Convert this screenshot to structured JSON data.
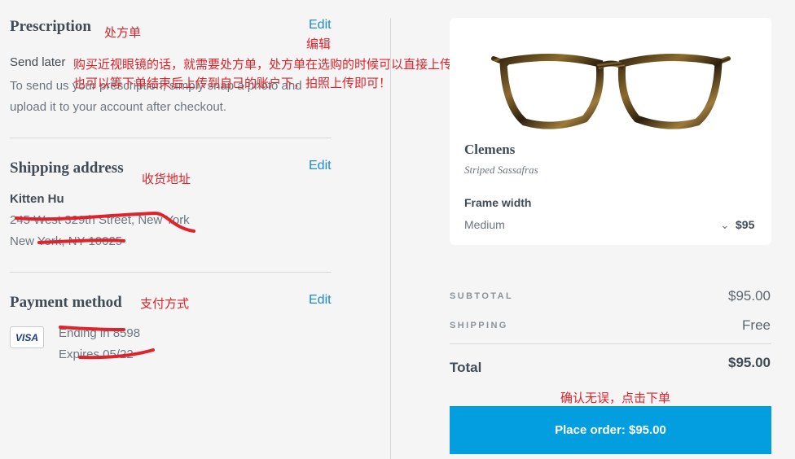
{
  "prescription": {
    "title": "Prescription",
    "annot_title": "处方单",
    "edit": "Edit",
    "annot_edit": "编辑",
    "option": "Send later",
    "desc_line1": "To send us your prescription, simply snap a photo and",
    "desc_line2": "upload it to your account after checkout.",
    "annot_line1": "购买近视眼镜的话，就需要处方单，处方单在选购的时候可以直接上传，",
    "annot_line2": "也可以等下单结束后上传到自己的账户下，拍照上传即可！"
  },
  "shipping": {
    "title": "Shipping address",
    "annot_title": "收货地址",
    "edit": "Edit",
    "name": "Kitten Hu",
    "line1": "245 West 329th Street, New York",
    "line2": "New York, NY 10025"
  },
  "payment": {
    "title": "Payment method",
    "annot_title": "支付方式",
    "edit": "Edit",
    "card_brand": "VISA",
    "ending": "Ending in 8598",
    "expires": "Expires 05/22"
  },
  "product": {
    "name": "Clemens",
    "color": "Striped Sassafras",
    "frame_width_label": "Frame width",
    "frame_width_value": "Medium",
    "price": "$95",
    "image": "glasses-icon"
  },
  "summary": {
    "subtotal_label": "SUBTOTAL",
    "subtotal_value": "$95.00",
    "shipping_label": "SHIPPING",
    "shipping_value": "Free",
    "total_label": "Total",
    "total_value": "$95.00"
  },
  "order": {
    "annot": "确认无误，点击下单",
    "button_label": "Place order: $95.00"
  },
  "colors": {
    "accent": "#039ee0",
    "link": "#1b8ad0",
    "annotation": "#e0222a",
    "background": "#f5f5f5"
  }
}
